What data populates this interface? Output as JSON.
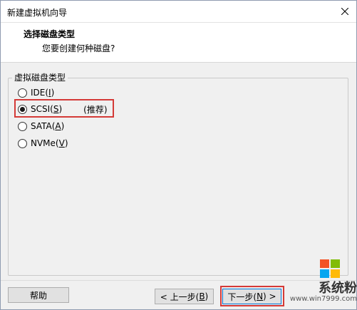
{
  "window": {
    "title": "新建虚拟机向导"
  },
  "header": {
    "title": "选择磁盘类型",
    "subtitle": "您要创建何种磁盘?"
  },
  "disk_type_group": {
    "label": "虚拟磁盘类型",
    "options": [
      {
        "label_prefix": "IDE(",
        "mnemonic": "I",
        "label_suffix": ")",
        "checked": false,
        "note": ""
      },
      {
        "label_prefix": "SCSI(",
        "mnemonic": "S",
        "label_suffix": ")",
        "checked": true,
        "note": "(推荐)"
      },
      {
        "label_prefix": "SATA(",
        "mnemonic": "A",
        "label_suffix": ")",
        "checked": false,
        "note": ""
      },
      {
        "label_prefix": "NVMe(",
        "mnemonic": "V",
        "label_suffix": ")",
        "checked": false,
        "note": ""
      }
    ]
  },
  "buttons": {
    "help": "帮助",
    "back_prefix": "< 上一步(",
    "back_mnemonic": "B",
    "back_suffix": ")",
    "next_prefix": "下一步(",
    "next_mnemonic": "N",
    "next_suffix": ") >"
  },
  "watermark": {
    "brand": "系统粉",
    "url": "www.win7999.com"
  },
  "colors": {
    "highlight": "#d43a37",
    "focus": "#0078d7",
    "logo_red": "#f35325",
    "logo_green": "#81bc06",
    "logo_blue": "#05a6f0",
    "logo_yellow": "#ffba08"
  },
  "icons": {
    "close": "close-icon",
    "logo": "windows-logo-icon"
  }
}
